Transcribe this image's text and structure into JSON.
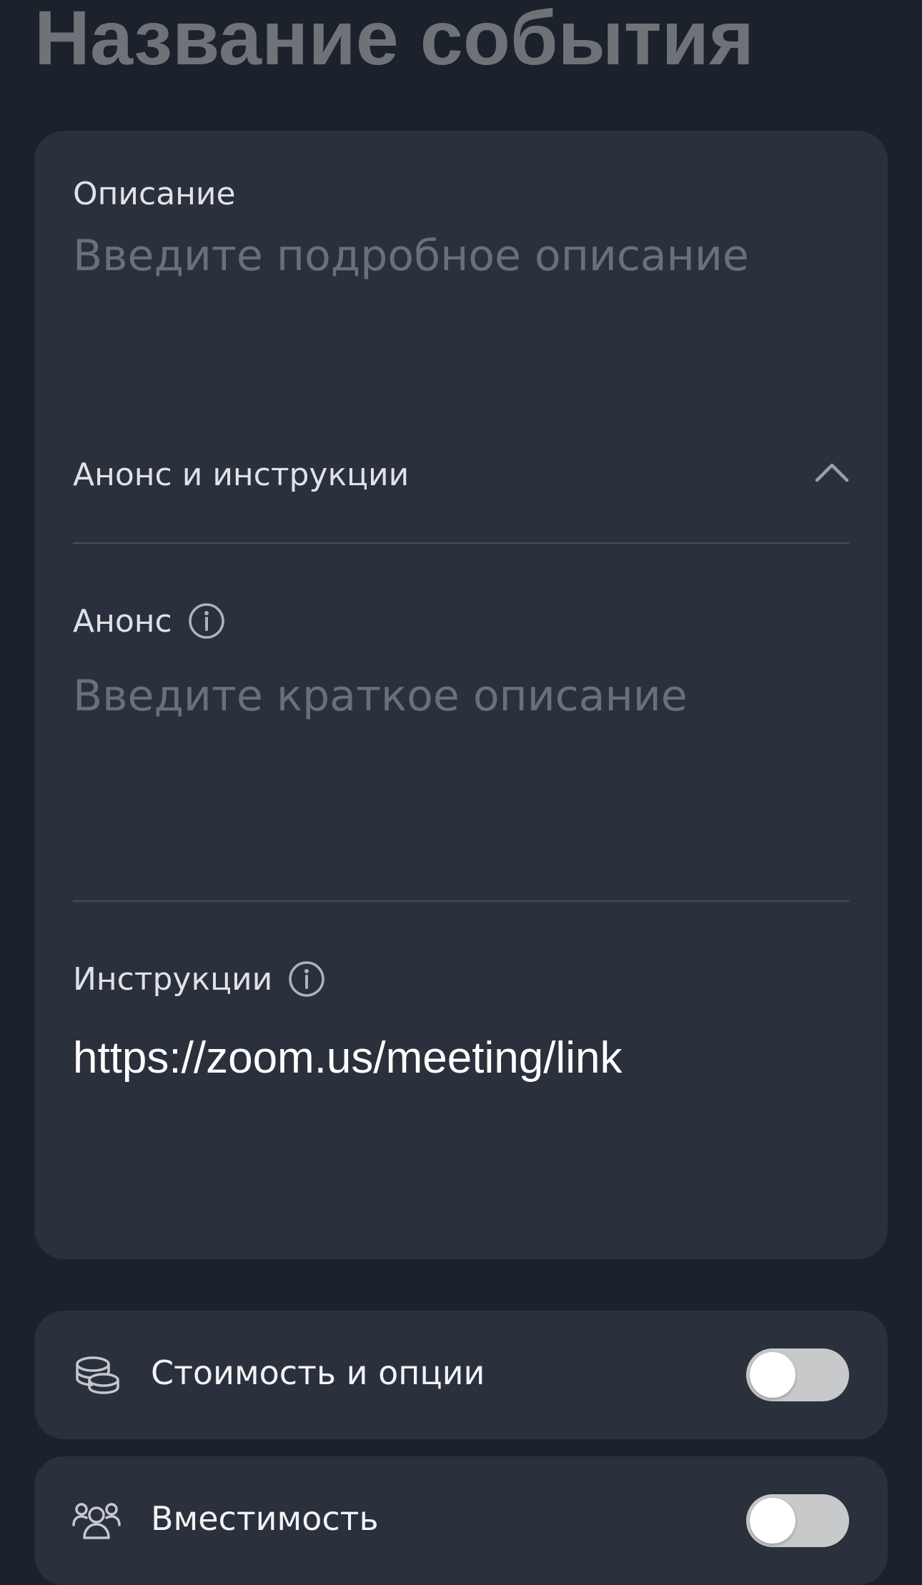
{
  "page": {
    "title": "Название события"
  },
  "details_card": {
    "description": {
      "label": "Описание",
      "placeholder": "Введите подробное описание",
      "value": ""
    },
    "announcements_section": {
      "label": "Анонс и инструкции",
      "expanded": true,
      "chevron_icon": "chevron-up-icon"
    },
    "announcement": {
      "label": "Анонс",
      "info_icon": "info-icon",
      "placeholder": "Введите краткое описание",
      "value": ""
    },
    "instructions": {
      "label": "Инструкции",
      "info_icon": "info-icon",
      "value": "https://zoom.us/meeting/link"
    }
  },
  "options": [
    {
      "label": "Стоимость и опции",
      "icon": "coins-icon",
      "enabled": false
    },
    {
      "label": "Вместимость",
      "icon": "users-icon",
      "enabled": false
    }
  ],
  "colors": {
    "background": "#1b222c",
    "card": "#2b313c",
    "title": "#6f7276",
    "placeholder": "#6b7078",
    "switch_off": "#c8c9cb"
  }
}
